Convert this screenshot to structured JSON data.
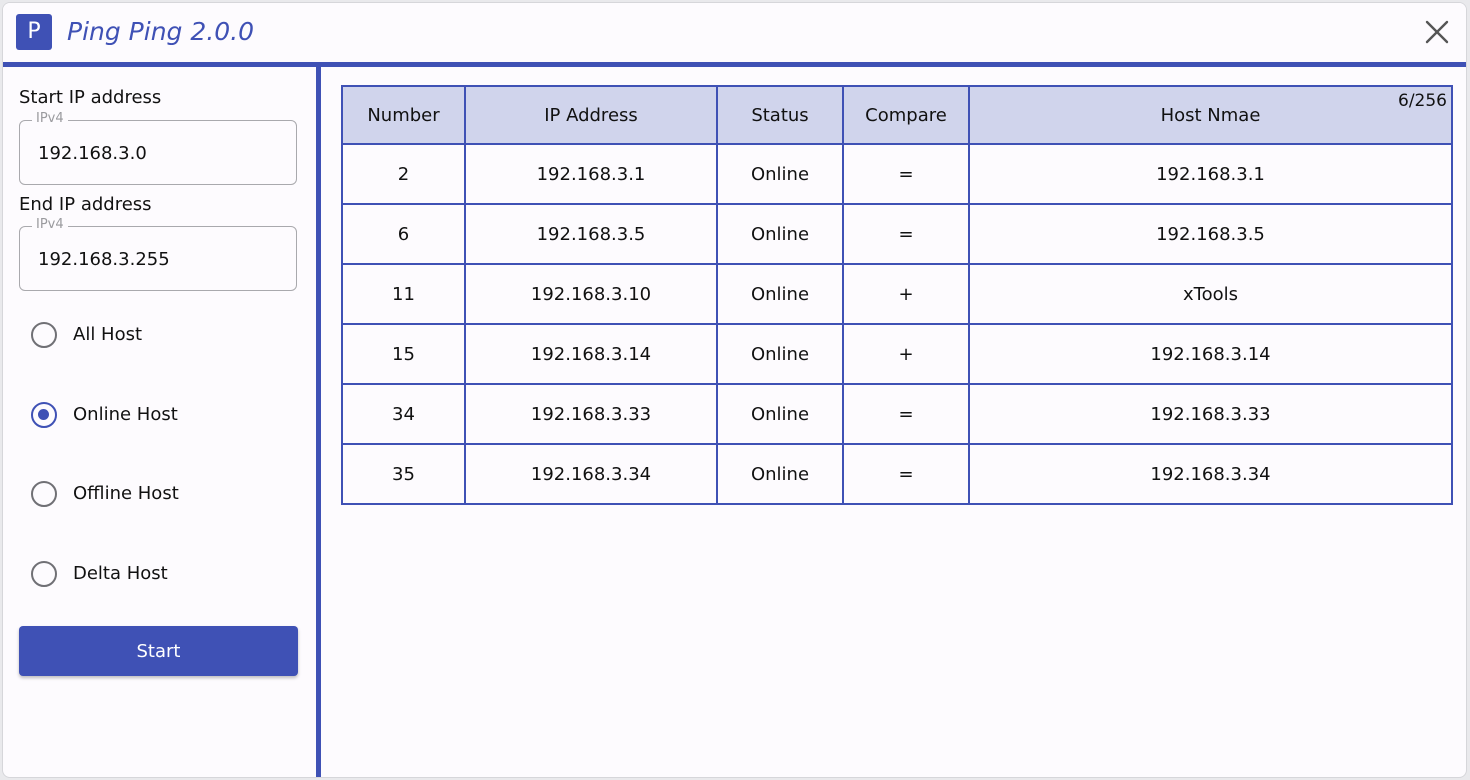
{
  "app": {
    "icon_letter": "P",
    "title": "Ping Ping 2.0.0"
  },
  "form": {
    "start_label": "Start IP address",
    "start_legend": "IPv4",
    "start_value": "192.168.3.0",
    "end_label": "End IP address",
    "end_legend": "IPv4",
    "end_value": "192.168.3.255"
  },
  "filters": [
    {
      "label": "All Host",
      "checked": false
    },
    {
      "label": "Online Host",
      "checked": true
    },
    {
      "label": "Offline Host",
      "checked": false
    },
    {
      "label": "Delta Host",
      "checked": false
    }
  ],
  "start_button": "Start",
  "results": {
    "count": "6/256",
    "columns": [
      "Number",
      "IP Address",
      "Status",
      "Compare",
      "Host Nmae"
    ],
    "rows": [
      [
        "2",
        "192.168.3.1",
        "Online",
        "=",
        "192.168.3.1"
      ],
      [
        "6",
        "192.168.3.5",
        "Online",
        "=",
        "192.168.3.5"
      ],
      [
        "11",
        "192.168.3.10",
        "Online",
        "+",
        "xTools"
      ],
      [
        "15",
        "192.168.3.14",
        "Online",
        "+",
        "192.168.3.14"
      ],
      [
        "34",
        "192.168.3.33",
        "Online",
        "=",
        "192.168.3.33"
      ],
      [
        "35",
        "192.168.3.34",
        "Online",
        "=",
        "192.168.3.34"
      ]
    ]
  },
  "colors": {
    "accent": "#3f51b5",
    "header_bg": "#d0d4ec",
    "online": "#4caf50"
  },
  "icons": {
    "close": "close-icon"
  }
}
